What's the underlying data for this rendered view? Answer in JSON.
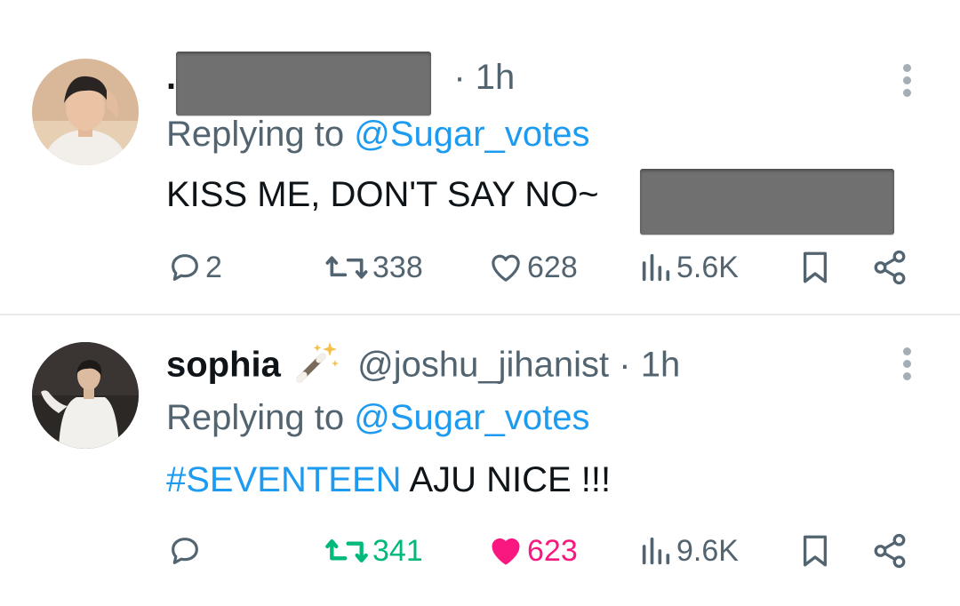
{
  "tweets": [
    {
      "display_name": ".",
      "handle": "",
      "time": "· 1h",
      "replying_prefix": "Replying to",
      "replying_to": "@Sugar_votes",
      "text": "KISS ME, DON'T SAY NO~",
      "hashtag": "",
      "replies": "2",
      "retweets": "338",
      "likes": "628",
      "views": "5.6K",
      "liked": false,
      "retweeted": false
    },
    {
      "display_name": "sophia",
      "emoji": "magic-wand-icon",
      "handle": "@joshu_jihanist",
      "time": "· 1h",
      "replying_prefix": "Replying to",
      "replying_to": "@Sugar_votes",
      "hashtag": "#SEVENTEEN",
      "text": " AJU NICE !!!",
      "replies": "",
      "retweets": "341",
      "likes": "623",
      "views": "9.6K",
      "liked": true,
      "retweeted": true
    }
  ],
  "colors": {
    "link": "#1d9bf0",
    "muted": "#536471",
    "retweet_active": "#00ba7c",
    "like_active": "#f91880",
    "redaction": "#707070"
  },
  "icons": [
    "reply-icon",
    "retweet-icon",
    "like-icon",
    "views-icon",
    "bookmark-icon",
    "share-icon",
    "more-icon"
  ]
}
